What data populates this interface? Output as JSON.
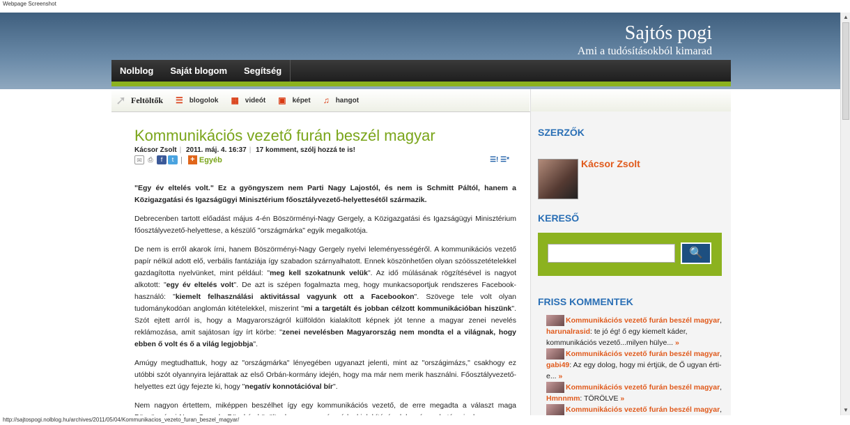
{
  "window": {
    "caption": "Webpage Screenshot"
  },
  "site": {
    "title": "Sajtós pogi",
    "subtitle": "Ami a tudósításokból kimarad"
  },
  "nav": {
    "items": [
      "Nolblog",
      "Saját blogom",
      "Segítség"
    ]
  },
  "subnav": {
    "label": "Feltöltők",
    "items": [
      {
        "icon": "list-icon",
        "glyph": "☰",
        "label": "blogolok"
      },
      {
        "icon": "film-icon",
        "glyph": "▦",
        "label": "videót"
      },
      {
        "icon": "image-icon",
        "glyph": "▣",
        "label": "képet"
      },
      {
        "icon": "music-icon",
        "glyph": "♫",
        "label": "hangot"
      }
    ]
  },
  "post": {
    "title": "Kommunikációs vezető furán beszél magyar",
    "author": "Kácsor Zsolt",
    "date": "2011. máj. 4. 16:37",
    "comments": "17 komment, szólj hozzá te is!",
    "category": "Egyéb",
    "p1_bold": "\"Egy év eltelés volt.\" Ez a gyöngyszem nem Parti Nagy Lajostól, és nem is Schmitt Páltól, hanem a Közigazgatási és Igazságügyi Minisztérium főosztályvezető-helyettesétől származik.",
    "p2": "Debrecenben tartott előadást május 4-én Böszörményi-Nagy Gergely, a Közigazgatási és Igazságügyi Minisztérium főosztályvezető-helyettese, a készülő \"országmárka\" egyik megalkotója.",
    "p3a": "De nem is erről akarok írni, hanem Böszörményi-Nagy Gergely nyelvi leleményességéről. A kommunikációs vezető papír nélkül adott elő, verbális fantáziája így szabadon szárnyalhatott. Ennek köszönhetően olyan szóösszetételekkel gazdagította nyelvünket, mint például: \"",
    "p3b": "meg kell szokatnunk velük",
    "p3c": "\". Az idő múlásának rögzítésével is nagyot alkotott: \"",
    "p3d": "egy év eltelés volt",
    "p3e": "\". De azt is szépen fogalmazta meg, hogy munkacsoportjuk rendszeres Facebook-használó: \"",
    "p3f": "kiemelt felhasználási aktivitással vagyunk ott a Facebookon",
    "p3g": "\". Szövege tele volt olyan tudománykodóan anglomán kitételekkel, miszerint \"",
    "p3h": "mi a targetált és jobban célzott kommunikációban hiszünk",
    "p3i": "\". Szót ejtett arról is, hogy a Magyarországról külföldön kialakított képnek jót tenne a magyar zenei nevelés reklámozása, amit sajátosan így írt körbe: \"",
    "p3j": "zenei nevelésben Magyarország nem mondta el a világnak, hogy ebben ő volt és ő a világ legjobbja",
    "p3k": "\".",
    "p4a": "Amúgy megtudhattuk, hogy az \"országmárka\" lényegében ugyanazt jelenti, mint az \"országimázs,\" csakhogy ez utóbbi szót olyannyira lejárattak az első Orbán-kormány idején, hogy ma már nem merik használni. Főosztályvezető-helyettes ezt úgy fejezte ki, hogy \"",
    "p4b": "negatív konnotációval bír",
    "p4c": "\".",
    "p5": "Nem nagyon értettem, miképpen beszélhet így egy kommunikációs vezető, de erre megadta a választ maga Böszörményi-Nagy Gergely. Büszkén közölte, hogy az országmárka kialakításán dolgozó munkatársainak"
  },
  "sidebar": {
    "authors_title": "SZERZŐK",
    "author_name": "Kácsor Zsolt",
    "search_title": "KERESŐ",
    "comments_title": "FRISS KOMMENTEK",
    "comments": [
      {
        "post": "Kommunikációs vezető furán beszél magyar",
        "sep": ",",
        "user": "harunalrasid",
        "text": ": te jó ég! ő egy kiemelt káder, kommunikációs vezető...milyen hülye...",
        "more": " »"
      },
      {
        "post": "Kommunikációs vezető furán beszél magyar",
        "sep": ",",
        "user": "gabi49",
        "text": ": Az egy dolog, hogy mi értjük, de Ő ugyan érti-e...",
        "more": " »"
      },
      {
        "post": "Kommunikációs vezető furán beszél magyar",
        "sep": ",",
        "user": "Hmnnmm",
        "text": ": TÖRÖLVE",
        "more": " »"
      },
      {
        "post": "Kommunikációs vezető furán beszél magyar",
        "sep": ",",
        "user": "",
        "text": "",
        "more": ""
      }
    ]
  },
  "status": {
    "url": "http://sajtospogi.nolblog.hu/archives/2011/05/04/Kommunikacios_vezeto_furan_beszel_magyar/"
  }
}
